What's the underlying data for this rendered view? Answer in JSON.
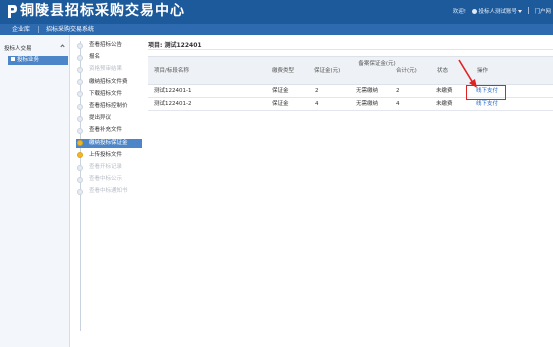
{
  "header": {
    "title": "铜陵县招标采购交易中心",
    "welcome": "欢迎!",
    "user_label": "投标人测试账号",
    "portal_label": "门户网"
  },
  "menubar": {
    "items": [
      "企业库",
      "招标采购交易系统"
    ]
  },
  "sidebar": {
    "section_title": "投标人交易",
    "active_item": "投标业务"
  },
  "steps": [
    {
      "label": "查看招标公告",
      "state": "done"
    },
    {
      "label": "报名",
      "state": "done"
    },
    {
      "label": "资格预审结果",
      "state": "disabled"
    },
    {
      "label": "缴纳招标文件费",
      "state": "done"
    },
    {
      "label": "下载招标文件",
      "state": "done"
    },
    {
      "label": "查看招标控制价",
      "state": "done"
    },
    {
      "label": "提出异议",
      "state": "done"
    },
    {
      "label": "查看补充文件",
      "state": "done"
    },
    {
      "label": "缴纳投标保证金",
      "state": "current"
    },
    {
      "label": "上传投标文件",
      "state": "warn"
    },
    {
      "label": "查看开标记录",
      "state": "disabled"
    },
    {
      "label": "查看中标公示",
      "state": "disabled"
    },
    {
      "label": "查看中标通知书",
      "state": "disabled"
    }
  ],
  "main": {
    "project_title": "项目: 测试122401",
    "table": {
      "headers": [
        "项目/标段名称",
        "缴费类型",
        "保证金(元)",
        "备案保证金(元)",
        "合计(元)",
        "状态",
        "操作"
      ],
      "rows": [
        {
          "name": "测试122401-1",
          "type": "保证金",
          "deposit": "2",
          "filed_deposit": "无需缴纳",
          "total": "2",
          "status": "未缴费",
          "action": "线下支付"
        },
        {
          "name": "测试122401-2",
          "type": "保证金",
          "deposit": "4",
          "filed_deposit": "无需缴纳",
          "total": "4",
          "status": "未缴费",
          "action": "线下支付"
        }
      ]
    }
  },
  "colors": {
    "header_bg": "#1c5a9c",
    "menubar_bg": "#2d6ab0",
    "active_bg": "#4d86c8",
    "link": "#1f63c7",
    "highlight": "#e02222",
    "step_warn": "#f1b626"
  }
}
